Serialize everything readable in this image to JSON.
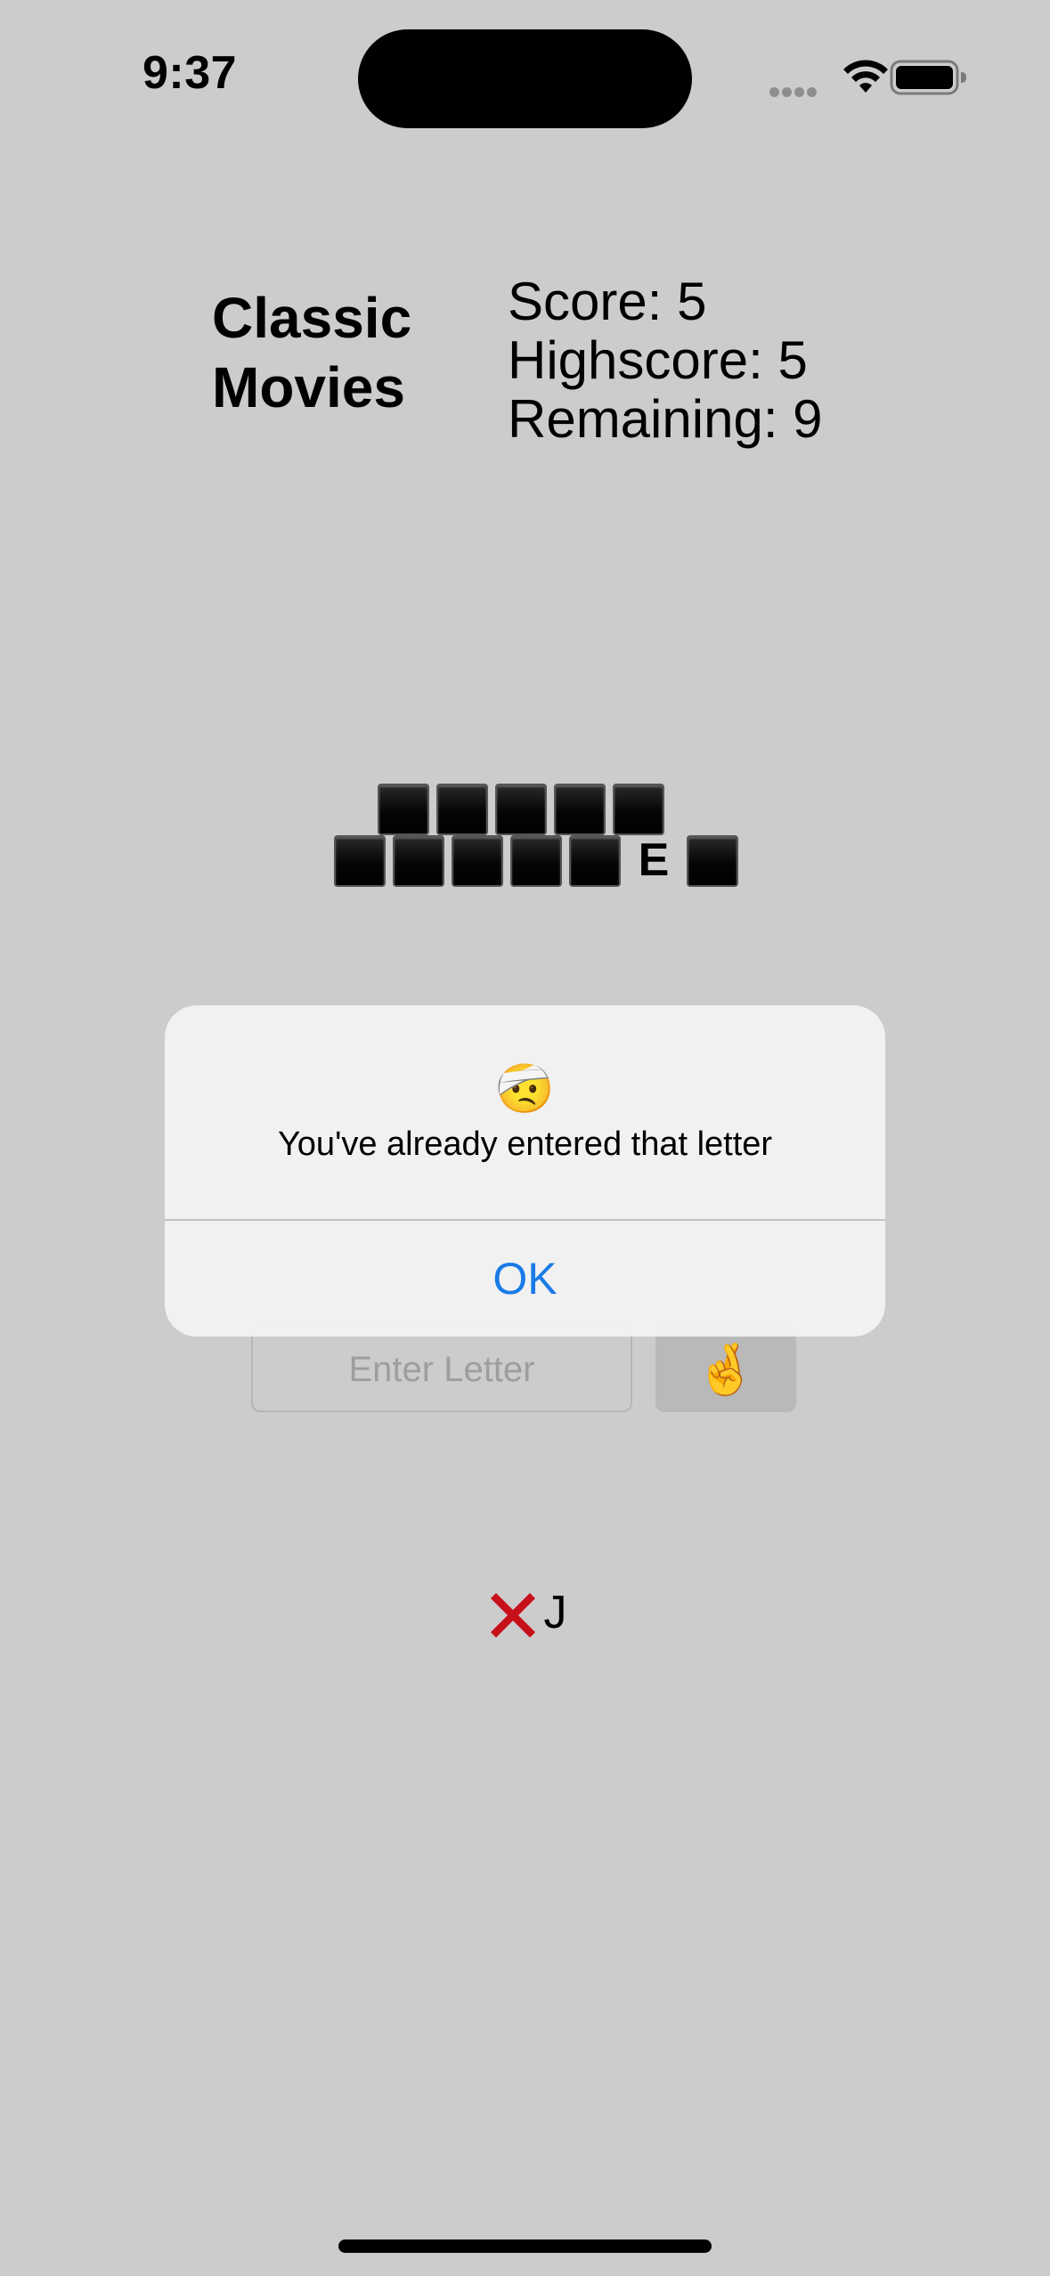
{
  "status_bar": {
    "time": "9:37"
  },
  "header": {
    "category": "Classic Movies",
    "score": "Score: 5",
    "highscore": "Highscore: 5",
    "remaining": "Remaining: 9"
  },
  "puzzle": {
    "rows": [
      [
        "",
        "",
        "",
        "",
        ""
      ],
      [
        "",
        "",
        "",
        "",
        "",
        "E",
        ""
      ]
    ]
  },
  "input": {
    "placeholder": "Enter Letter",
    "value": "",
    "guess_button": "🤞"
  },
  "wrong_guesses": {
    "marker": "x-icon",
    "letters": "J"
  },
  "alert": {
    "emoji": "🤕",
    "message": "You've already entered that letter",
    "ok_label": "OK",
    "ok_color": "#1a7be6"
  },
  "colors": {
    "background": "#cccccc",
    "wrong_marker": "#c8101a"
  }
}
